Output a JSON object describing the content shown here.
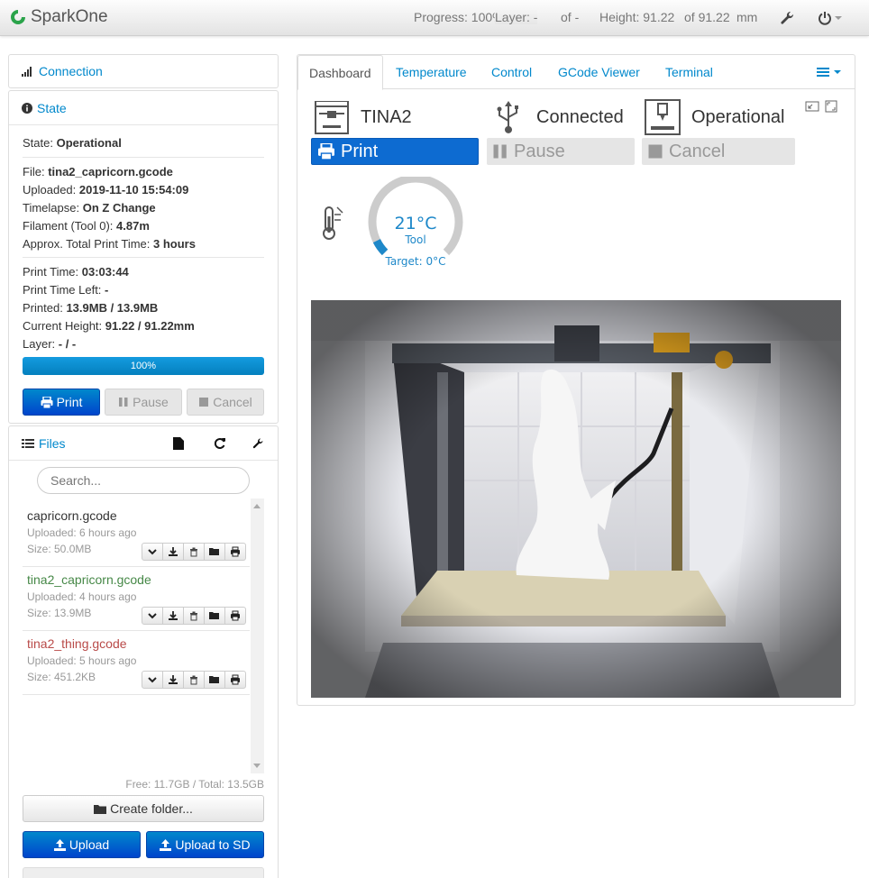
{
  "navbar": {
    "brand": "SparkOne",
    "progress": "Progress: 100%",
    "layer": "Layer: -",
    "layer_of": "of -",
    "height": "Height: 91.22",
    "height_of": "of 91.22",
    "height_unit": "mm",
    "icons": [
      "wrench-icon",
      "power-icon"
    ]
  },
  "connection": {
    "title": "Connection"
  },
  "state": {
    "title": "State",
    "state_label": "State:",
    "state_value": "Operational",
    "file_label": "File:",
    "file_value": "tina2_capricorn.gcode",
    "uploaded_label": "Uploaded:",
    "uploaded_value": "2019-11-10 15:54:09",
    "timelapse_label": "Timelapse:",
    "timelapse_value": "On Z Change",
    "filament_label": "Filament (Tool 0):",
    "filament_value": "4.87m",
    "approx_label": "Approx. Total Print Time:",
    "approx_value": "3 hours",
    "print_time_label": "Print Time:",
    "print_time_value": "03:03:44",
    "time_left_label": "Print Time Left:",
    "time_left_value": "-",
    "printed_label": "Printed:",
    "printed_value": "13.9MB / 13.9MB",
    "height_label": "Current Height:",
    "height_value": "91.22 / 91.22mm",
    "layer_label": "Layer:",
    "layer_value": "- / -",
    "progress": 1.0,
    "progress_text": "100%",
    "print_button": "Print",
    "pause_button": "Pause",
    "cancel_button": "Cancel"
  },
  "files": {
    "title": "Files",
    "search_placeholder": "Search...",
    "items": [
      {
        "name": "capricorn.gcode",
        "uploaded": "Uploaded: 6 hours ago",
        "size": "Size: 50.0MB",
        "color": "#333333"
      },
      {
        "name": "tina2_capricorn.gcode",
        "uploaded": "Uploaded: 4 hours ago",
        "size": "Size: 13.9MB",
        "color": "#468847"
      },
      {
        "name": "tina2_thing.gcode",
        "uploaded": "Uploaded: 5 hours ago",
        "size": "Size: 451.2KB",
        "color": "#b94a48"
      }
    ],
    "free": "Free: 11.7GB / Total: 13.5GB",
    "create_folder": "Create folder...",
    "upload": "Upload",
    "upload_sd": "Upload to SD"
  },
  "tabs": [
    "Dashboard",
    "Temperature",
    "Control",
    "GCode Viewer",
    "Terminal"
  ],
  "dashboard": {
    "printer_name": "TINA2",
    "connection_status": "Connected",
    "printer_state": "Operational",
    "print_button": "Print",
    "pause_button": "Pause",
    "cancel_button": "Cancel",
    "temp_value": "21°C",
    "temp_tool": "Tool",
    "temp_target": "Target: 0°C",
    "temp_fraction": 0.07
  },
  "colors": {
    "accent": "#0088cc",
    "primary_button": "#0044cc",
    "gauge_fill": "#1e88c9",
    "gauge_track": "#cccccc"
  }
}
